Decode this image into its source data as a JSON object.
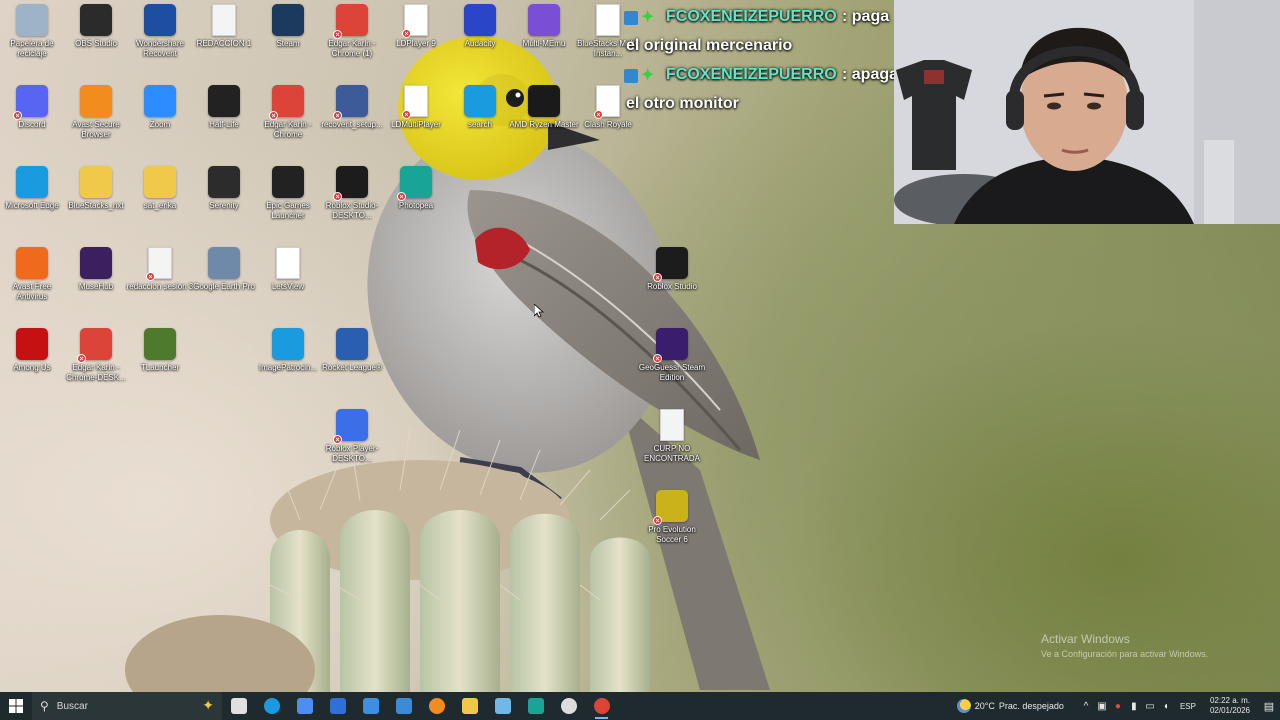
{
  "desktop_icons": [
    {
      "id": "recycle-bin",
      "label": "Papelera de reciclaje",
      "icon": "recycle-bin-icon",
      "color": "#9fb3c8",
      "badge": false
    },
    {
      "id": "obs-studio",
      "label": "OBS Studio",
      "icon": "obs-icon",
      "color": "#2b2b2b",
      "badge": false
    },
    {
      "id": "wondershare",
      "label": "Wondershare Recoverit",
      "icon": "wondershare-icon",
      "color": "#1d4fa0",
      "badge": false
    },
    {
      "id": "redaccion1",
      "label": "REDACCION 1",
      "icon": "document-icon",
      "color": "#f4f4f4",
      "badge": false
    },
    {
      "id": "steam",
      "label": "Steam",
      "icon": "steam-icon",
      "color": "#1b3a5c",
      "badge": false
    },
    {
      "id": "edgar-chrome-1",
      "label": "Edgar Karin - Chrome (1)",
      "icon": "chrome-icon",
      "color": "#db4437",
      "badge": true
    },
    {
      "id": "ldplayer9",
      "label": "LDPlayer 9",
      "icon": "file-icon",
      "color": "#ffffff",
      "badge": true
    },
    {
      "id": "audacity",
      "label": "Audacity",
      "icon": "audacity-icon",
      "color": "#2b45c8",
      "badge": false
    },
    {
      "id": "multimemu",
      "label": "Multi-MEmu",
      "icon": "memu-icon",
      "color": "#7a4fd6",
      "badge": false
    },
    {
      "id": "bluestacks-multi",
      "label": "BlueStacks Multi-Instan...",
      "icon": "file-icon",
      "color": "#ffffff",
      "badge": false
    },
    {
      "id": "discord",
      "label": "Discord",
      "icon": "discord-icon",
      "color": "#5865f2",
      "badge": true
    },
    {
      "id": "avast-browser",
      "label": "Avast Secure Browser",
      "icon": "avast-browser-icon",
      "color": "#f28c1e",
      "badge": false
    },
    {
      "id": "zoom",
      "label": "Zoom",
      "icon": "zoom-icon",
      "color": "#2d8cff",
      "badge": false
    },
    {
      "id": "half-life",
      "label": "Half-Life",
      "icon": "half-life-icon",
      "color": "#222222",
      "badge": false
    },
    {
      "id": "edgar-chrome",
      "label": "Edgar Karin - Chrome",
      "icon": "chrome-icon",
      "color": "#db4437",
      "badge": true
    },
    {
      "id": "recoverit-setup",
      "label": "recoverit_setup...",
      "icon": "installer-icon",
      "color": "#3d5a99",
      "badge": true
    },
    {
      "id": "ldmultiplayer",
      "label": "LDMultiPlayer",
      "icon": "file-icon",
      "color": "#ffffff",
      "badge": true
    },
    {
      "id": "search",
      "label": "search",
      "icon": "edge-icon",
      "color": "#1a9be0",
      "badge": false
    },
    {
      "id": "amd-ryzen",
      "label": "AMD Ryzen Master",
      "icon": "ryzen-icon",
      "color": "#1a1a1a",
      "badge": false
    },
    {
      "id": "clash-royale",
      "label": "Clash Royale",
      "icon": "file-icon",
      "color": "#ffffff",
      "badge": true
    },
    {
      "id": "ms-edge",
      "label": "Microsoft Edge",
      "icon": "edge-icon",
      "color": "#1a9be0",
      "badge": false
    },
    {
      "id": "bluestacks-nxt",
      "label": "BlueStacks_nxt",
      "icon": "folder-icon",
      "color": "#f0c84a",
      "badge": false
    },
    {
      "id": "sat-erika",
      "label": "sat_erika",
      "icon": "folder-icon",
      "color": "#f0c84a",
      "badge": false
    },
    {
      "id": "serenity",
      "label": "Serenity",
      "icon": "serenity-icon",
      "color": "#2c2c2c",
      "badge": false
    },
    {
      "id": "epic-games",
      "label": "Epic Games Launcher",
      "icon": "epic-icon",
      "color": "#222222",
      "badge": false
    },
    {
      "id": "roblox-studio-desktop",
      "label": "Roblox Studio-DESKTO...",
      "icon": "roblox-icon",
      "color": "#1c1c1c",
      "badge": true
    },
    {
      "id": "photopea",
      "label": "Photopea",
      "icon": "photopea-icon",
      "color": "#18a497",
      "badge": true
    },
    {
      "id": "avast-av",
      "label": "Avast Free Antivirus",
      "icon": "avast-icon",
      "color": "#f06a1d",
      "badge": false
    },
    {
      "id": "musehub",
      "label": "MuseHub",
      "icon": "musehub-icon",
      "color": "#3b1f5e",
      "badge": false
    },
    {
      "id": "redaccion-sesion",
      "label": "redaccion sesion 3",
      "icon": "document-icon",
      "color": "#f4f4f4",
      "badge": true
    },
    {
      "id": "google-earth",
      "label": "Google Earth Pro",
      "icon": "earth-icon",
      "color": "#6f8aa8",
      "badge": false
    },
    {
      "id": "letsview",
      "label": "LetsView",
      "icon": "letsview-icon",
      "color": "#ffffff",
      "badge": false
    },
    {
      "id": "roblox-studio",
      "label": "Roblox Studio",
      "icon": "roblox-icon",
      "color": "#1c1c1c",
      "badge": true
    },
    {
      "id": "among-us",
      "label": "Among Us",
      "icon": "among-us-icon",
      "color": "#c51111",
      "badge": false
    },
    {
      "id": "edgar-chrome-desk",
      "label": "Edgar Karin - Chrome-DESK...",
      "icon": "chrome-icon",
      "color": "#db4437",
      "badge": true
    },
    {
      "id": "tlauncher",
      "label": "TLauncher",
      "icon": "minecraft-icon",
      "color": "#4e7a2c",
      "badge": false
    },
    {
      "id": "imagepatrocin",
      "label": "ImagePatrocin...",
      "icon": "edge-icon",
      "color": "#1a9be0",
      "badge": false
    },
    {
      "id": "rocket-league",
      "label": "Rocket League®",
      "icon": "rocket-league-icon",
      "color": "#2a5fb0",
      "badge": false
    },
    {
      "id": "geoguessr",
      "label": "GeoGuessr Steam Edition",
      "icon": "geoguessr-icon",
      "color": "#3a1e6d",
      "badge": true
    },
    {
      "id": "roblox-player",
      "label": "Roblox Player-DESKTO...",
      "icon": "roblox-player-icon",
      "color": "#3c6ee8",
      "badge": true
    },
    {
      "id": "curp",
      "label": "CURP NO ENCONTRADA",
      "icon": "document-icon",
      "color": "#f4f4f4",
      "badge": false
    },
    {
      "id": "pes6",
      "label": "Pro Evolution Soccer 6",
      "icon": "pes-icon",
      "color": "#c9b21a",
      "badge": true
    }
  ],
  "chat": [
    {
      "user": "FCOXENEIZEPUERRO",
      "text1": ": paga",
      "text2": "el original mercenario"
    },
    {
      "user": "FCOXENEIZEPUERRO",
      "text1": ": apaga",
      "text2": "el otro monitor"
    }
  ],
  "watermark": {
    "title": "Activar Windows",
    "subtitle": "Ve a Configuración para activar Windows."
  },
  "taskbar": {
    "search_placeholder": "Buscar",
    "apps": [
      {
        "name": "task-view",
        "icon": "task-view-icon",
        "color": "#e0e0e0"
      },
      {
        "name": "edge",
        "icon": "edge-icon",
        "color": "#1a9be0"
      },
      {
        "name": "copilot",
        "icon": "copilot-icon",
        "color": "#4d8ef0"
      },
      {
        "name": "mail",
        "icon": "mail-icon",
        "color": "#2f6fd8"
      },
      {
        "name": "store",
        "icon": "store-icon",
        "color": "#3f8fe0"
      },
      {
        "name": "vscode",
        "icon": "vscode-icon",
        "color": "#3b8bd6"
      },
      {
        "name": "avast-browser",
        "icon": "avast-browser-icon",
        "color": "#f28c1e"
      },
      {
        "name": "file-explorer",
        "icon": "folder-icon",
        "color": "#f0c84a"
      },
      {
        "name": "notepad",
        "icon": "notepad-icon",
        "color": "#6fb8e8"
      },
      {
        "name": "photopea",
        "icon": "photopea-icon",
        "color": "#18a497"
      },
      {
        "name": "obs",
        "icon": "obs-icon",
        "color": "#dddddd"
      },
      {
        "name": "chrome",
        "icon": "chrome-icon",
        "color": "#db4437"
      }
    ],
    "weather": {
      "temp": "20°C",
      "desc": "Prac. despejado"
    },
    "lang": "ESP",
    "time": "02:22 a. m.",
    "date": "02/01/2026"
  }
}
